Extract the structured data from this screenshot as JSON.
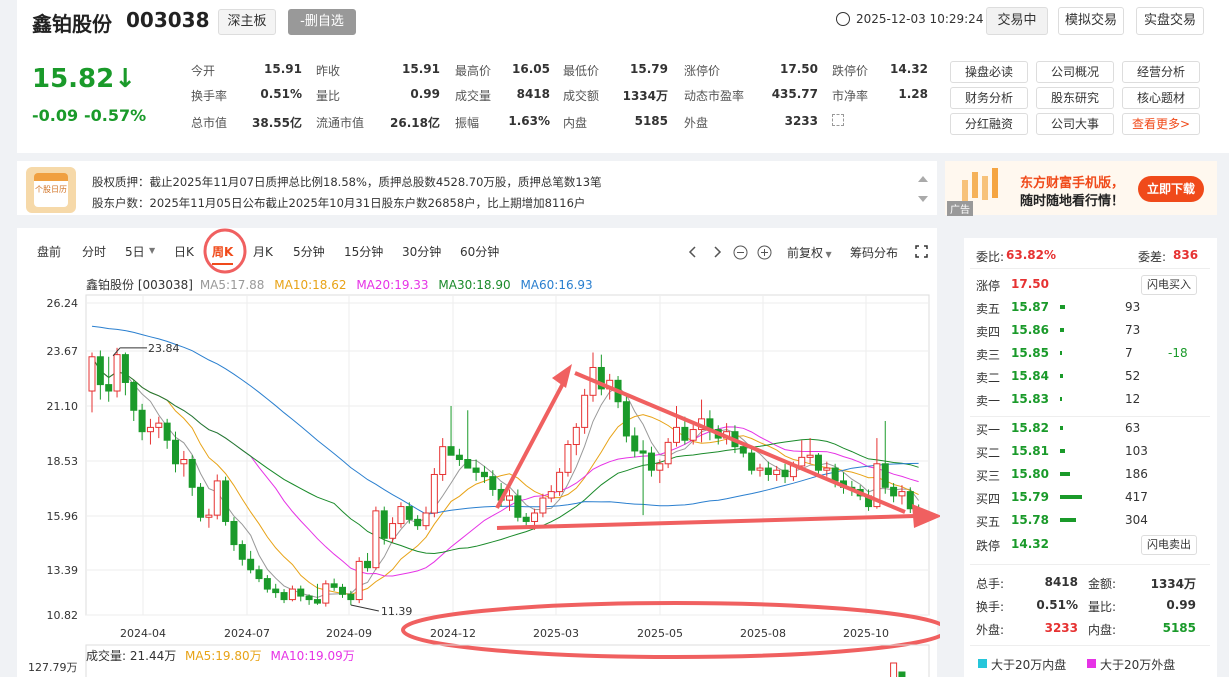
{
  "stock": {
    "name": "鑫铂股份",
    "code": "003038",
    "board": "深主板",
    "remove_label": "-删自选"
  },
  "header": {
    "datetime": "2025-12-03 10:29:24",
    "trade_btn": "交易中",
    "sim_btn": "模拟交易",
    "real_btn": "实盘交易"
  },
  "price": {
    "current": "15.82↓",
    "change": "-0.09",
    "pct": "-0.57%"
  },
  "quote": [
    [
      "今开",
      "15.91",
      "昨收",
      "15.91",
      "最高价",
      "16.05",
      "最低价",
      "15.79",
      "涨停价",
      "17.50",
      "跌停价",
      "14.32"
    ],
    [
      "换手率",
      "0.51%",
      "量比",
      "0.99",
      "成交量",
      "8418",
      "成交额",
      "1334万",
      "动态市盈率",
      "435.77",
      "市净率",
      "1.28"
    ],
    [
      "总市值",
      "38.55亿",
      "流通市值",
      "26.18亿",
      "振幅",
      "1.63%",
      "内盘",
      "5185",
      "外盘",
      "3233",
      "",
      ""
    ]
  ],
  "quick_links": [
    "操盘必读",
    "公司概况",
    "经营分析",
    "财务分析",
    "股东研究",
    "核心题材",
    "分红融资",
    "公司大事",
    "查看更多>"
  ],
  "notices": {
    "pledge": "股权质押：截止2025年11月07日质押总比例18.58%，质押总股数4528.70万股，质押总笔数13笔",
    "holders": "股东户数：2025年11月05日公布截止2025年10月31日股东户数26858户，比上期增加8116户",
    "icon_text": "个股日历"
  },
  "ad": {
    "title": "东方财富手机版，",
    "subtitle": "随时随地看行情！",
    "button": "立即下载",
    "tag": "广告"
  },
  "chart_tabs": [
    "盘前",
    "分时",
    "5日",
    "日K",
    "周K",
    "月K",
    "5分钟",
    "15分钟",
    "30分钟",
    "60分钟"
  ],
  "chart_tools": {
    "adjust": "前复权",
    "chip": "筹码分布"
  },
  "ma_legend": {
    "title": "鑫铂股份 [003038]",
    "ma5": "MA5:17.88",
    "ma10": "MA10:18.62",
    "ma20": "MA20:19.33",
    "ma30": "MA30:18.90",
    "ma60": "MA60:16.93"
  },
  "vol_legend": {
    "vol": "成交量: 21.44万",
    "ma5": "MA5:19.80万",
    "ma10": "MA10:19.09万",
    "ymax": "127.79万"
  },
  "colors": {
    "ma5": "#999999",
    "ma10": "#e8a317",
    "ma20": "#e633e6",
    "ma30": "#1a8a2a",
    "ma60": "#2a7fcf",
    "up": "#e63232",
    "down": "#1a9a2a",
    "annot": "#f06060"
  },
  "orderbook": {
    "weibi_label": "委比:",
    "weibi": "63.82%",
    "weicha_label": "委差:",
    "weicha": "836",
    "zt_label": "涨停",
    "zt": "17.50",
    "flash_buy": "闪电买入",
    "asks": [
      [
        "卖五",
        "15.87",
        "93",
        ""
      ],
      [
        "卖四",
        "15.86",
        "73",
        ""
      ],
      [
        "卖三",
        "15.85",
        "7",
        "-18"
      ],
      [
        "卖二",
        "15.84",
        "52",
        ""
      ],
      [
        "卖一",
        "15.83",
        "12",
        ""
      ]
    ],
    "bids": [
      [
        "买一",
        "15.82",
        "63"
      ],
      [
        "买二",
        "15.81",
        "103"
      ],
      [
        "买三",
        "15.80",
        "186"
      ],
      [
        "买四",
        "15.79",
        "417"
      ],
      [
        "买五",
        "15.78",
        "304"
      ]
    ],
    "dt_label": "跌停",
    "dt": "14.32",
    "flash_sell": "闪电卖出"
  },
  "stats": [
    [
      "总手:",
      "8418",
      "金额:",
      "1334万"
    ],
    [
      "换手:",
      "0.51%",
      "量比:",
      "0.99"
    ],
    [
      "外盘:",
      "3233",
      "内盘:",
      "5185"
    ]
  ],
  "flow_legend": {
    "inner": "大于20万内盘",
    "outer": "大于20万外盘"
  },
  "chart_data": {
    "type": "candlestick",
    "y_ticks": [
      "26.24",
      "23.67",
      "21.10",
      "18.53",
      "15.96",
      "13.39",
      "10.82"
    ],
    "ylim": [
      10.82,
      26.24
    ],
    "x_ticks": [
      "2024-04",
      "2024-07",
      "2024-09",
      "2024-12",
      "2025-03",
      "2025-05",
      "2025-08",
      "2025-10"
    ],
    "annotations": {
      "high": "23.84",
      "low": "11.39"
    },
    "candles": [
      [
        21.8,
        23.6,
        20.8,
        23.4
      ],
      [
        23.4,
        23.7,
        21.4,
        22.1
      ],
      [
        22.1,
        23.4,
        21.3,
        21.8
      ],
      [
        21.8,
        23.84,
        21.5,
        23.5
      ],
      [
        23.5,
        23.6,
        21.6,
        22.2
      ],
      [
        22.2,
        22.3,
        20.4,
        20.9
      ],
      [
        20.9,
        21.2,
        19.5,
        19.9
      ],
      [
        19.9,
        20.5,
        19.3,
        20.1
      ],
      [
        20.1,
        20.6,
        19.6,
        20.3
      ],
      [
        20.3,
        20.5,
        19.1,
        19.5
      ],
      [
        19.5,
        19.9,
        18.0,
        18.4
      ],
      [
        18.4,
        19.0,
        17.8,
        18.6
      ],
      [
        18.6,
        18.8,
        16.9,
        17.3
      ],
      [
        17.3,
        17.5,
        15.7,
        15.9
      ],
      [
        15.9,
        16.3,
        15.4,
        16.0
      ],
      [
        16.0,
        17.9,
        15.8,
        17.6
      ],
      [
        17.6,
        17.8,
        15.5,
        15.7
      ],
      [
        15.7,
        15.9,
        14.3,
        14.6
      ],
      [
        14.6,
        14.8,
        13.6,
        13.9
      ],
      [
        13.9,
        14.3,
        13.2,
        13.4
      ],
      [
        13.4,
        13.6,
        12.7,
        12.9
      ],
      [
        12.9,
        13.1,
        12.1,
        12.3
      ],
      [
        12.3,
        12.6,
        11.8,
        12.1
      ],
      [
        12.1,
        12.3,
        11.5,
        11.7
      ],
      [
        11.7,
        12.5,
        11.6,
        12.3
      ],
      [
        12.3,
        12.5,
        11.6,
        11.9
      ],
      [
        11.9,
        12.0,
        11.4,
        11.7
      ],
      [
        11.7,
        12.6,
        11.4,
        11.5
      ],
      [
        11.5,
        12.8,
        11.3,
        12.6
      ],
      [
        12.6,
        12.9,
        12.2,
        12.4
      ],
      [
        12.4,
        12.6,
        11.8,
        12.0
      ],
      [
        12.0,
        12.2,
        11.39,
        11.7
      ],
      [
        11.7,
        14.0,
        11.5,
        13.8
      ],
      [
        13.8,
        14.2,
        13.3,
        13.5
      ],
      [
        13.5,
        16.4,
        13.4,
        16.2
      ],
      [
        16.2,
        16.4,
        14.6,
        14.9
      ],
      [
        14.9,
        15.9,
        14.7,
        15.6
      ],
      [
        15.6,
        16.6,
        15.4,
        16.4
      ],
      [
        16.4,
        16.6,
        15.6,
        15.8
      ],
      [
        15.8,
        16.0,
        15.3,
        15.5
      ],
      [
        15.5,
        16.4,
        15.3,
        16.1
      ],
      [
        16.1,
        18.2,
        15.9,
        17.9
      ],
      [
        17.9,
        19.6,
        17.6,
        19.2
      ],
      [
        19.2,
        21.1,
        18.9,
        18.8
      ],
      [
        18.8,
        19.1,
        18.3,
        18.6
      ],
      [
        18.6,
        20.9,
        18.4,
        18.2
      ],
      [
        18.2,
        18.6,
        17.6,
        18.0
      ],
      [
        18.0,
        18.3,
        17.5,
        17.8
      ],
      [
        17.8,
        18.1,
        16.9,
        17.2
      ],
      [
        17.2,
        17.5,
        16.4,
        16.7
      ],
      [
        16.7,
        17.2,
        16.2,
        16.9
      ],
      [
        16.9,
        17.2,
        15.7,
        15.9
      ],
      [
        15.9,
        16.1,
        15.5,
        15.7
      ],
      [
        15.7,
        16.3,
        15.3,
        16.1
      ],
      [
        16.1,
        17.0,
        15.9,
        16.8
      ],
      [
        16.8,
        17.4,
        16.6,
        17.1
      ],
      [
        17.1,
        18.2,
        16.9,
        18.0
      ],
      [
        18.0,
        19.5,
        17.8,
        19.3
      ],
      [
        19.3,
        20.3,
        18.8,
        20.1
      ],
      [
        20.1,
        21.9,
        19.8,
        21.6
      ],
      [
        21.6,
        23.6,
        21.3,
        22.9
      ],
      [
        22.9,
        23.5,
        21.6,
        21.9
      ],
      [
        21.9,
        22.6,
        21.4,
        22.3
      ],
      [
        22.3,
        22.5,
        21.0,
        21.3
      ],
      [
        21.3,
        21.6,
        19.4,
        19.7
      ],
      [
        19.7,
        20.1,
        18.7,
        19.0
      ],
      [
        19.0,
        19.5,
        16.0,
        18.9
      ],
      [
        18.9,
        19.2,
        17.8,
        18.1
      ],
      [
        18.1,
        18.6,
        17.5,
        18.4
      ],
      [
        18.4,
        19.6,
        18.2,
        19.4
      ],
      [
        19.4,
        21.1,
        19.2,
        20.1
      ],
      [
        20.1,
        20.6,
        19.3,
        19.5
      ],
      [
        19.5,
        20.3,
        19.3,
        20.0
      ],
      [
        20.0,
        21.4,
        19.4,
        20.5
      ],
      [
        20.5,
        20.9,
        19.5,
        20.0
      ],
      [
        20.0,
        20.2,
        19.3,
        19.6
      ],
      [
        19.6,
        20.3,
        19.3,
        19.9
      ],
      [
        19.9,
        20.2,
        18.9,
        19.2
      ],
      [
        19.2,
        19.4,
        18.7,
        18.9
      ],
      [
        18.9,
        19.1,
        17.9,
        18.1
      ],
      [
        18.1,
        18.4,
        17.8,
        18.2
      ],
      [
        18.2,
        18.5,
        17.6,
        17.9
      ],
      [
        17.9,
        18.3,
        17.6,
        18.1
      ],
      [
        18.1,
        18.4,
        17.5,
        17.8
      ],
      [
        17.8,
        18.5,
        17.6,
        18.3
      ],
      [
        18.3,
        19.5,
        18.1,
        18.7
      ],
      [
        18.7,
        19.6,
        18.4,
        18.8
      ],
      [
        18.8,
        18.9,
        17.9,
        18.1
      ],
      [
        18.1,
        18.5,
        17.8,
        18.2
      ],
      [
        18.2,
        18.4,
        17.3,
        17.6
      ],
      [
        17.6,
        18.0,
        17.0,
        17.3
      ],
      [
        17.3,
        17.6,
        16.9,
        17.2
      ],
      [
        17.2,
        17.4,
        16.7,
        16.9
      ],
      [
        16.9,
        17.2,
        16.2,
        16.4
      ],
      [
        16.4,
        19.6,
        16.3,
        18.4
      ],
      [
        18.4,
        20.4,
        17.0,
        17.3
      ],
      [
        17.3,
        17.5,
        16.6,
        16.9
      ],
      [
        16.9,
        17.4,
        16.5,
        17.1
      ],
      [
        17.1,
        17.3,
        16.1,
        16.3
      ],
      [
        16.3,
        16.5,
        15.8,
        15.82
      ]
    ]
  }
}
